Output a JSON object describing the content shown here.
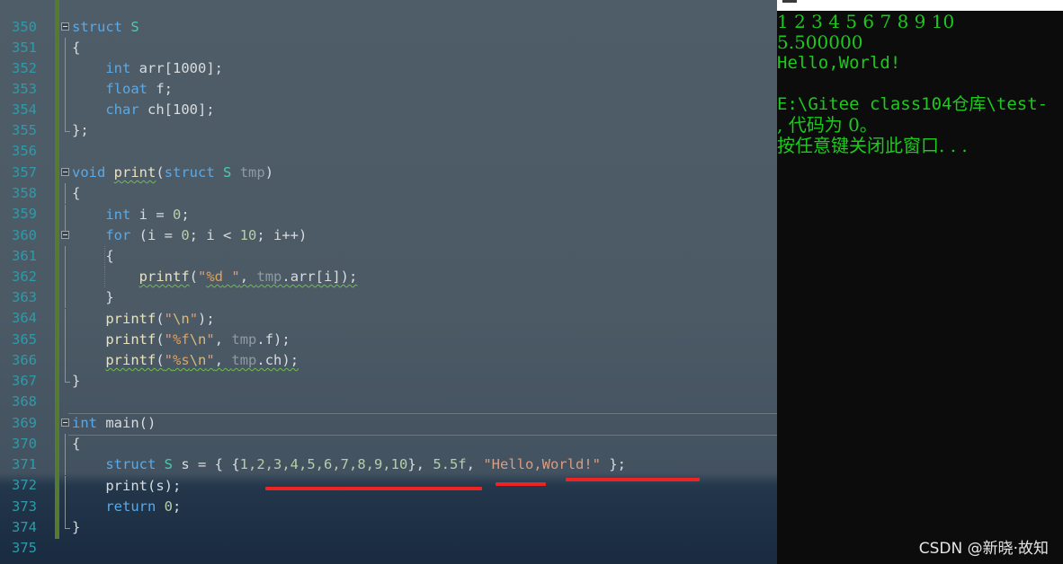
{
  "editor": {
    "line_numbers": [
      "350",
      "351",
      "352",
      "353",
      "354",
      "355",
      "356",
      "357",
      "358",
      "359",
      "360",
      "361",
      "362",
      "363",
      "364",
      "365",
      "366",
      "367",
      "368",
      "369",
      "370",
      "371",
      "372",
      "373",
      "374",
      "375"
    ]
  },
  "code": {
    "l351_kw": "struct",
    "l351_ty": "S",
    "l352": "{",
    "l353_kw": "int",
    "l353_rest": " arr[1000];",
    "l354_kw": "float",
    "l354_rest": " f;",
    "l355_kw": "char",
    "l355_rest": " ch[100];",
    "l356": "};",
    "l358_kw": "void",
    "l358_fn": "print",
    "l358_open": "(",
    "l358_kw2": "struct",
    "l358_ty": "S",
    "l358_param": "tmp",
    "l358_close": ")",
    "l359": "{",
    "l360_kw": "int",
    "l360_a": " i = ",
    "l360_num": "0",
    "l360_b": ";",
    "l361_kw": "for",
    "l361_a": " (i = ",
    "l361_n0": "0",
    "l361_b": "; i < ",
    "l361_n10": "10",
    "l361_c": "; i++)",
    "l362": "{",
    "l363_fn": "printf",
    "l363_open": "(",
    "l363_q1": "\"",
    "l363_fmt": "%d",
    "l363_q2": " \"",
    "l363_comma": ", ",
    "l363_param": "tmp",
    "l363_rest": ".arr[i]);",
    "l364": "}",
    "l365_fn": "printf",
    "l365_open": "(",
    "l365_q1": "\"",
    "l365_esc": "\\n",
    "l365_q2": "\"",
    "l365_rest": ");",
    "l366_fn": "printf",
    "l366_open": "(",
    "l366_q1": "\"",
    "l366_fmt": "%f",
    "l366_esc": "\\n",
    "l366_q2": "\"",
    "l366_comma": ", ",
    "l366_param": "tmp",
    "l366_rest": ".f);",
    "l367_fn": "printf",
    "l367_open": "(",
    "l367_q1": "\"",
    "l367_fmt": "%s",
    "l367_esc": "\\n",
    "l367_q2": "\"",
    "l367_comma": ", ",
    "l367_param": "tmp",
    "l367_rest": ".ch);",
    "l368": "}",
    "l370_kw": "int",
    "l370_rest": " main()",
    "l371": "{",
    "l372_kw": "struct",
    "l372_ty": "S",
    "l372_a": " s = { {",
    "l372_nums": "1,2,3,4,5,6,7,8,9,10",
    "l372_b": "}, ",
    "l372_float": "5.5f",
    "l372_c": ", ",
    "l372_str": "\"Hello,World!\"",
    "l372_d": " };",
    "l373": "print(s);",
    "l374_kw": "return",
    "l374_a": " ",
    "l374_num": "0",
    "l374_b": ";",
    "l375": "}"
  },
  "console": {
    "line1": "1 2 3 4 5 6 7 8 9 10",
    "line2": "5.500000",
    "line3": "Hello,World!",
    "line4": "",
    "line5": "E:\\Gitee class104仓库\\test-",
    "line6": ", 代码为 0。",
    "line7": "按任意键关闭此窗口. . ."
  },
  "watermark": "CSDN @新晓·故知",
  "colors": {
    "console_text": "#1ec81e",
    "keyword": "#5aa9e6",
    "type": "#4ec9b0",
    "line_number": "#2f9aa8",
    "annotation_red": "#ee2424",
    "change_bar": "#557b2e"
  }
}
